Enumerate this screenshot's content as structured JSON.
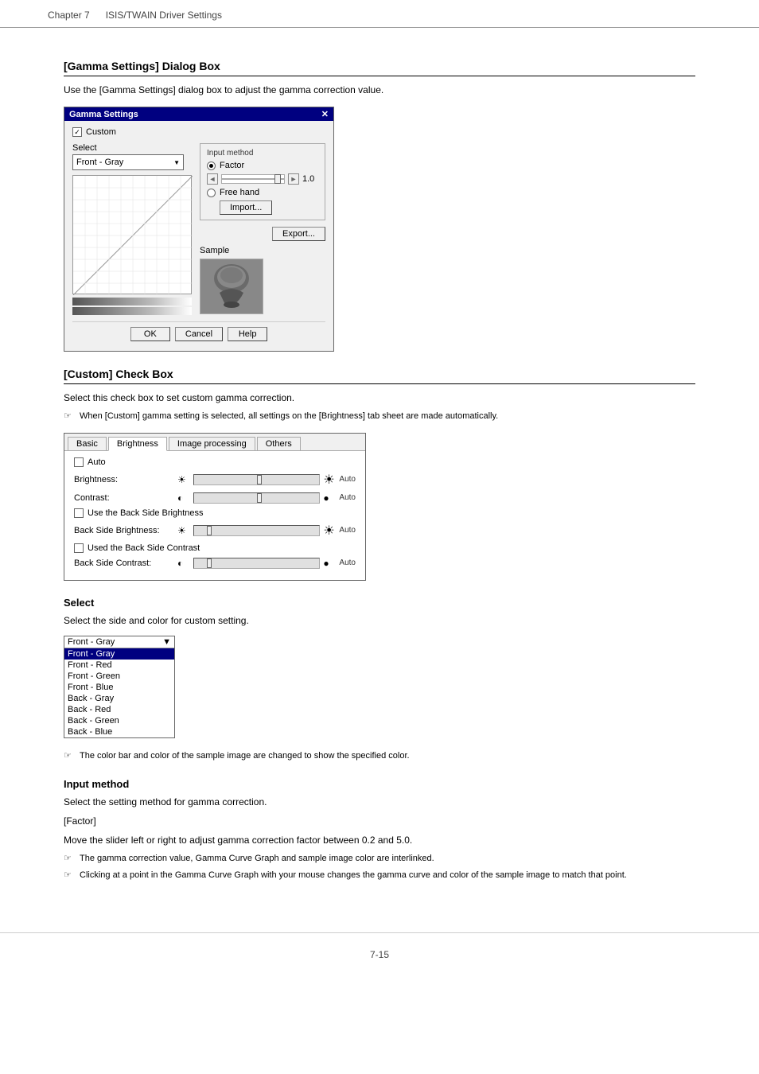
{
  "header": {
    "chapter": "Chapter 7",
    "title": "ISIS/TWAIN Driver Settings"
  },
  "sections": {
    "gamma_dialog": {
      "title": "[Gamma Settings] Dialog Box",
      "description": "Use the [Gamma Settings] dialog box to adjust the gamma correction value.",
      "dialog": {
        "title": "Gamma Settings",
        "custom_label": "Custom",
        "custom_checked": true,
        "select_group_label": "Select",
        "select_value": "Front - Gray",
        "input_method_label": "Input method",
        "factor_label": "Factor",
        "factor_value": "1.0",
        "free_hand_label": "Free hand",
        "import_label": "Import...",
        "export_label": "Export...",
        "sample_label": "Sample",
        "ok_label": "OK",
        "cancel_label": "Cancel",
        "help_label": "Help"
      }
    },
    "custom_checkbox": {
      "title": "[Custom] Check Box",
      "description": "Select this check box to set custom gamma correction.",
      "note": "When [Custom] gamma setting is selected, all settings on the [Brightness] tab sheet are made automatically.",
      "tabs": {
        "tab_items": [
          "Basic",
          "Brightness",
          "Image processing",
          "Others"
        ],
        "active_tab": "Brightness"
      },
      "brightness_rows": [
        {
          "label": "Auto",
          "type": "checkbox",
          "checked": false
        },
        {
          "label": "Brightness:",
          "icon_left": "☀",
          "icon_right": "☀",
          "auto": "Auto"
        },
        {
          "label": "Contrast:",
          "icon_left": "●",
          "icon_right": "●",
          "auto": "Auto"
        },
        {
          "label": "Use the Back Side Brightness",
          "type": "checkbox"
        },
        {
          "label": "Back Side Brightness:",
          "icon_left": "☀",
          "icon_right": "☀",
          "auto": "Auto"
        },
        {
          "label": "Used the Back Side Contrast",
          "type": "checkbox"
        },
        {
          "label": "Back Side Contrast:",
          "icon_left": "●",
          "icon_right": "●",
          "auto": "Auto"
        }
      ]
    },
    "select_section": {
      "title": "Select",
      "description": "Select the side and color for custom setting.",
      "dropdown_items": [
        "Front - Gray",
        "Front - Gray",
        "Front - Red",
        "Front - Green",
        "Front - Blue",
        "Back - Gray",
        "Back - Red",
        "Back - Green",
        "Back - Blue"
      ],
      "note": "The color bar and color of the sample image are changed to show the specified color."
    },
    "input_method": {
      "title": "Input method",
      "description": "Select the setting method for gamma correction.",
      "factor_title": "[Factor]",
      "factor_desc": "Move the slider left or right to adjust gamma correction factor between 0.2 and 5.0.",
      "notes": [
        "The gamma correction value, Gamma Curve Graph and sample image color are interlinked.",
        "Clicking at a point in the Gamma Curve Graph with your mouse changes the gamma curve and color of the sample image to match that point."
      ]
    }
  },
  "footer": {
    "page_number": "7-15"
  }
}
